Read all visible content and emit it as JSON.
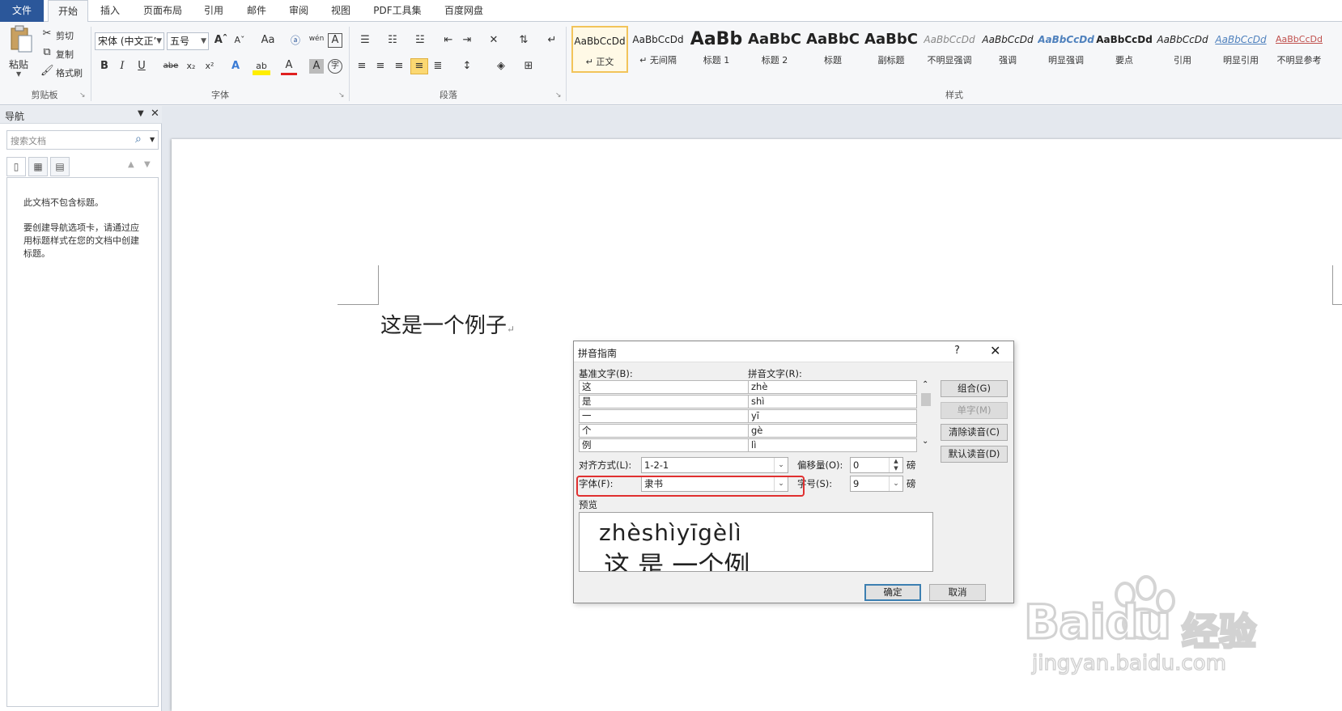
{
  "tabs": {
    "file": "文件",
    "home": "开始",
    "insert": "插入",
    "layout": "页面布局",
    "references": "引用",
    "mailings": "邮件",
    "review": "审阅",
    "view": "视图",
    "pdf": "PDF工具集",
    "baidu": "百度网盘"
  },
  "clipboard": {
    "paste": "粘贴",
    "cut": "剪切",
    "copy": "复制",
    "format_painter": "格式刷",
    "group": "剪贴板"
  },
  "font": {
    "name": "宋体 (中文正’",
    "size": "五号",
    "group": "字体",
    "grow": "Aˆ",
    "shrink": "Aˇ",
    "case": "Aa",
    "bold": "B",
    "italic": "I",
    "underline": "U",
    "strike": "abe",
    "sub": "x₂",
    "sup": "x²",
    "effects": "A",
    "highlight": "ab",
    "color": "A",
    "char_shade": "A",
    "enclose": "字",
    "phonetic": "wén",
    "clear": "A"
  },
  "paragraph": {
    "group": "段落"
  },
  "styles": {
    "group": "样式",
    "items": [
      {
        "preview": "AaBbCcDd",
        "name": "↵ 正文"
      },
      {
        "preview": "AaBbCcDd",
        "name": "↵ 无间隔"
      },
      {
        "preview": "AaBb",
        "name": "标题 1"
      },
      {
        "preview": "AaBbC",
        "name": "标题 2"
      },
      {
        "preview": "AaBbC",
        "name": "标题"
      },
      {
        "preview": "AaBbC",
        "name": "副标题"
      },
      {
        "preview": "AaBbCcDd",
        "name": "不明显强调"
      },
      {
        "preview": "AaBbCcDd",
        "name": "强调"
      },
      {
        "preview": "AaBbCcDd",
        "name": "明显强调"
      },
      {
        "preview": "AaBbCcDd",
        "name": "要点"
      },
      {
        "preview": "AaBbCcDd",
        "name": "引用"
      },
      {
        "preview": "AaBbCcDd",
        "name": "明显引用"
      },
      {
        "preview": "AaBbCcDd",
        "name": "不明显参考"
      }
    ]
  },
  "nav": {
    "title": "导航",
    "search_placeholder": "搜索文档",
    "msg1": "此文档不包含标题。",
    "msg2": "要创建导航选项卡，请通过应用标题样式在您的文档中创建标题。"
  },
  "document": {
    "text": "这是一个例子",
    "para_mark": "↵"
  },
  "dialog": {
    "title": "拼音指南",
    "help": "?",
    "base_label": "基准文字(B):",
    "ruby_label": "拼音文字(R):",
    "rows": [
      {
        "base": "这",
        "ruby": "zhè"
      },
      {
        "base": "是",
        "ruby": "shì"
      },
      {
        "base": "一",
        "ruby": "yī"
      },
      {
        "base": "个",
        "ruby": "gè"
      },
      {
        "base": "例",
        "ruby": "lì"
      }
    ],
    "btn_group": "组合(G)",
    "btn_mono": "单字(M)",
    "btn_clear": "清除读音(C)",
    "btn_default": "默认读音(D)",
    "align_label": "对齐方式(L):",
    "align_value": "1-2-1",
    "offset_label": "偏移量(O):",
    "offset_value": "0",
    "offset_unit": "磅",
    "font_label": "字体(F):",
    "font_value": "隶书",
    "size_label": "字号(S):",
    "size_value": "9",
    "size_unit": "磅",
    "preview_label": "预览",
    "preview_ruby": "zhèshìyīgèlì",
    "preview_base": "这 是 一个例",
    "ok": "确定",
    "cancel": "取消"
  },
  "watermark": {
    "brand": "Baidu",
    "cn": "经验",
    "url": "jingyan.baidu.com"
  }
}
